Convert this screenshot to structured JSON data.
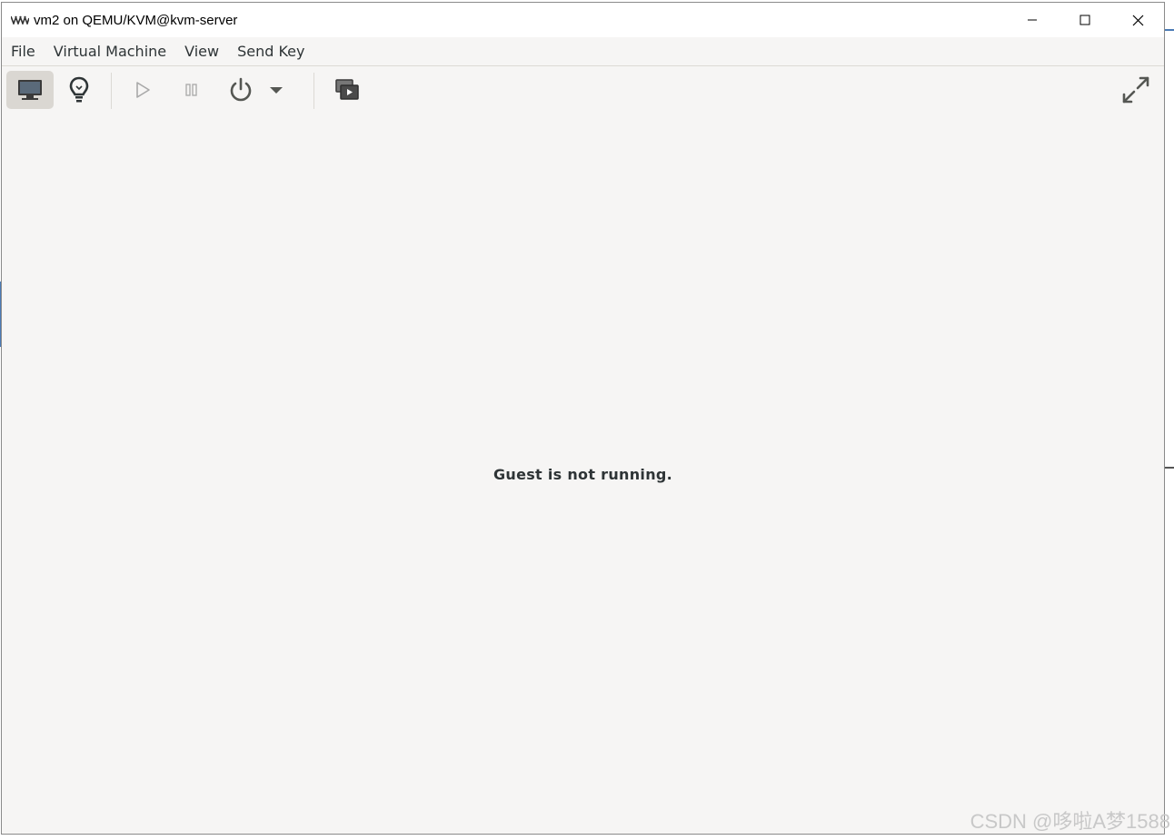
{
  "window": {
    "title": "vm2 on QEMU/KVM@kvm-server"
  },
  "window_controls": [
    {
      "name": "minimize",
      "icon": "minimize-icon"
    },
    {
      "name": "maximize",
      "icon": "maximize-icon"
    },
    {
      "name": "close",
      "icon": "close-icon"
    }
  ],
  "menu": {
    "items": [
      "File",
      "Virtual Machine",
      "View",
      "Send Key"
    ]
  },
  "toolbar": {
    "buttons": [
      {
        "name": "console-view",
        "icon": "monitor-icon",
        "active": true
      },
      {
        "name": "details-view",
        "icon": "lightbulb-icon",
        "active": false
      },
      {
        "name": "run",
        "icon": "play-icon",
        "enabled": false
      },
      {
        "name": "pause",
        "icon": "pause-icon",
        "enabled": false
      },
      {
        "name": "shutdown",
        "icon": "power-icon",
        "enabled": true
      },
      {
        "name": "shutdown-menu",
        "icon": "chevron-down-icon",
        "enabled": true
      },
      {
        "name": "snapshots",
        "icon": "snapshots-icon",
        "enabled": true
      },
      {
        "name": "fullscreen",
        "icon": "fullscreen-icon",
        "enabled": true
      }
    ]
  },
  "main": {
    "status_message": "Guest is not running."
  },
  "watermark": "CSDN @哆啦A梦1588",
  "colors": {
    "window_bg": "#f6f5f4",
    "text": "#2e3436",
    "active_button_bg": "#dad7d2",
    "icon": "#555753",
    "icon_disabled": "#a8a8a8"
  }
}
